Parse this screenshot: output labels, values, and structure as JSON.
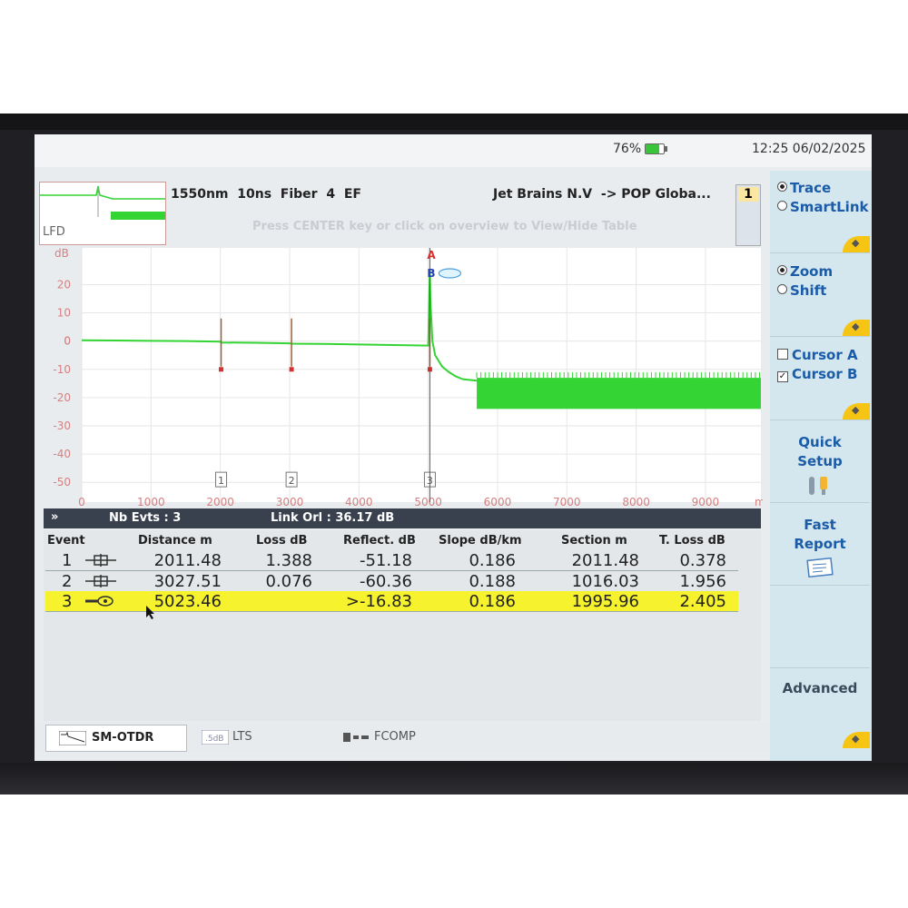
{
  "status": {
    "battery": "76%",
    "time": "12:25  06/02/2025"
  },
  "header": {
    "overview_label": "LFD",
    "trace_info": "1550nm  10ns  Fiber  4  EF",
    "route_info": "Jet Brains N.V  -> POP Globa...",
    "hint": "Press CENTER key or click on overview to View/Hide Table",
    "trace_number": "1"
  },
  "chart_data": {
    "type": "line",
    "xlabel": "m",
    "ylabel": "dB",
    "xlim": [
      0,
      9800
    ],
    "ylim": [
      -57,
      33
    ],
    "x_ticks": [
      "0",
      "1000",
      "2000",
      "3000",
      "4000",
      "5000",
      "6000",
      "7000",
      "8000",
      "9000"
    ],
    "y_ticks": [
      "20",
      "10",
      "0",
      "-10",
      "-20",
      "-30",
      "-40",
      "-50"
    ],
    "series": [
      {
        "x": [
          0,
          500,
          1000,
          1500,
          2000,
          2011,
          2500,
          3000,
          3027,
          3500,
          4000,
          4500,
          5000,
          5023,
          5030,
          5060,
          5100,
          5200,
          5300,
          5400,
          5500,
          5700
        ],
        "y": [
          0.3,
          0.2,
          0.1,
          0.0,
          -0.2,
          -0.5,
          -0.6,
          -0.8,
          -0.9,
          -1.0,
          -1.2,
          -1.4,
          -1.6,
          25,
          15,
          0,
          -5,
          -9,
          -11,
          -12.5,
          -13.5,
          -14
        ]
      }
    ],
    "noise_band": {
      "x_start": 5700,
      "x_end": 9800,
      "y_top": -13,
      "y_bottom": -24
    },
    "cursors": [
      {
        "name": "A",
        "x": 5023
      },
      {
        "name": "B",
        "x": 5023
      }
    ],
    "events": [
      {
        "label": "1",
        "x": 2011.48
      },
      {
        "label": "2",
        "x": 3027.51
      },
      {
        "label": "3",
        "x": 5023.46
      }
    ]
  },
  "table": {
    "summary": {
      "chevron": "»",
      "nb_evts": "Nb Evts : 3",
      "link_orl": "Link Orl :  36.17 dB"
    },
    "headers": [
      "Event",
      "Distance  m",
      "Loss dB",
      "Reflect. dB",
      "Slope  dB/km",
      "Section m",
      "T. Loss dB"
    ],
    "rows": [
      {
        "event": "1",
        "distance": "2011.48",
        "loss": "1.388",
        "reflect": "-51.18",
        "slope": "0.186",
        "section": "2011.48",
        "tloss": "0.378",
        "icon": "splice-icon"
      },
      {
        "event": "2",
        "distance": "3027.51",
        "loss": "0.076",
        "reflect": "-60.36",
        "slope": "0.188",
        "section": "1016.03",
        "tloss": "1.956",
        "icon": "splice-icon"
      },
      {
        "event": "3",
        "distance": "5023.46",
        "loss": "",
        "reflect": ">-16.83",
        "slope": "0.186",
        "section": "1995.96",
        "tloss": "2.405",
        "icon": "fiber-end-icon"
      }
    ]
  },
  "tabs": [
    "SM-OTDR",
    "LTS",
    "FCOMP"
  ],
  "sidebar": {
    "trace": "Trace",
    "smartlink": "SmartLink",
    "zoom": "Zoom",
    "shift": "Shift",
    "cursor_a": "Cursor A",
    "cursor_b": "Cursor B",
    "quick_setup_1": "Quick",
    "quick_setup_2": "Setup",
    "fast_report_1": "Fast",
    "fast_report_2": "Report",
    "advanced": "Advanced"
  },
  "colors": {
    "trace": "#33d433",
    "selected_row": "#f6f22d",
    "accent": "#1a5ca8",
    "cursor_a": "#d83030",
    "cursor_b": "#2a40b0"
  }
}
